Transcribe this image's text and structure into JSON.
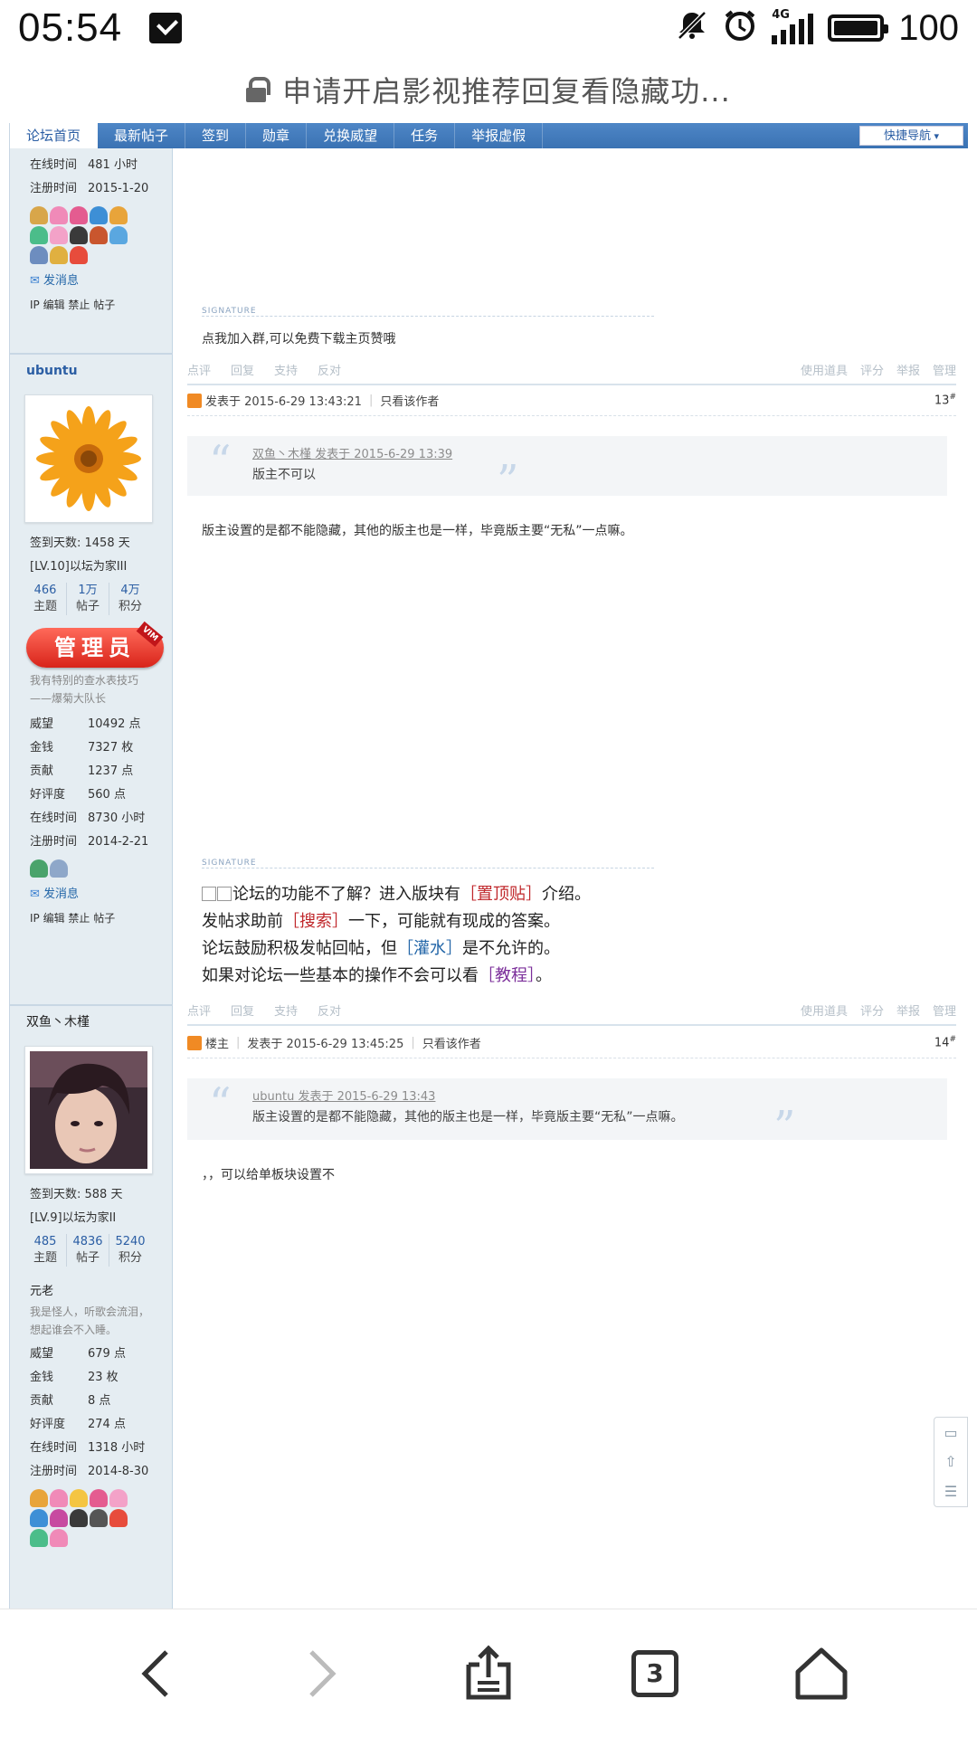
{
  "status_bar": {
    "time": "05:54",
    "alarm_icon": "alarm-clock-icon",
    "mute_icon": "bell-off-icon",
    "network": "4G",
    "battery": "100"
  },
  "url_bar": {
    "title": "申请开启影视推荐回复看隐藏功..."
  },
  "forum_nav": {
    "items": [
      "论坛首页",
      "最新帖子",
      "签到",
      "勋章",
      "兑换威望",
      "任务",
      "举报虚假"
    ],
    "quick_nav": "快捷导航"
  },
  "post12_tail": {
    "online_label": "在线时间",
    "online_value": "481 小时",
    "register_label": "注册时间",
    "register_value": "2015-1-20",
    "pm": "发消息",
    "ip_line": "IP 编辑 禁止 帖子",
    "signature_label": "SIGNATURE",
    "signature": "点我加入群,可以免费下载主页赞哦",
    "actions": [
      "点评",
      "回复",
      "支持",
      "反对"
    ],
    "actions_right": [
      "使用道具",
      "评分",
      "举报",
      "管理"
    ]
  },
  "post13": {
    "username": "ubuntu",
    "posted": "发表于 2015-6-29 13:43:21",
    "only_author": "只看该作者",
    "floor": "13",
    "quote_by": "双鱼丶木槿 发表于 2015-6-29 13:39",
    "quote_text": "版主不可以",
    "body": "版主设置的是都不能隐藏，其他的版主也是一样，毕竟版主要“无私”一点嘛。",
    "signin_days": "签到天数: 1458 天",
    "level": "[LV.10]以坛为家III",
    "stats": [
      {
        "n": "466",
        "l": "主题"
      },
      {
        "n": "1万",
        "l": "帖子"
      },
      {
        "n": "4万",
        "l": "积分"
      }
    ],
    "badge": "管理员",
    "badge_corner": "VIM",
    "motto": "我有特别的查水表技巧——爆菊大队长",
    "info": [
      {
        "k": "威望",
        "v": "10492 点"
      },
      {
        "k": "金钱",
        "v": "7327 枚"
      },
      {
        "k": "贡献",
        "v": "1237 点"
      },
      {
        "k": "好评度",
        "v": "560 点"
      },
      {
        "k": "在线时间",
        "v": "8730 小时"
      },
      {
        "k": "注册时间",
        "v": "2014-2-21"
      }
    ],
    "pm": "发消息",
    "ip_line": "IP 编辑 禁止 帖子",
    "signature_label": "SIGNATURE",
    "sig_lines": [
      {
        "pre": "论坛的功能不了解？进入版块有",
        "link": "［置顶贴］",
        "post": "介绍。"
      },
      {
        "pre": "发帖求助前",
        "link": "［搜索］",
        "post": "一下，可能就有现成的答案。"
      },
      {
        "pre": "论坛鼓励积极发帖回帖，但",
        "link": "［灌水］",
        "post": "是不允许的。"
      },
      {
        "pre": "如果对论坛一些基本的操作不会可以看",
        "link": "［教程］",
        "post": "。"
      }
    ],
    "actions": [
      "点评",
      "回复",
      "支持",
      "反对"
    ],
    "actions_right": [
      "使用道具",
      "评分",
      "举报",
      "管理"
    ]
  },
  "post14": {
    "username": "双鱼丶木槿",
    "op_tag": "楼主",
    "posted": "发表于 2015-6-29 13:45:25",
    "only_author": "只看该作者",
    "floor": "14",
    "quote_by": "ubuntu 发表于 2015-6-29 13:43",
    "quote_text": "版主设置的是都不能隐藏，其他的版主也是一样，毕竟版主要“无私”一点嘛。",
    "body": "，，可以给单板块设置不",
    "signin_days": "签到天数: 588 天",
    "level": "[LV.9]以坛为家II",
    "stats": [
      {
        "n": "485",
        "l": "主题"
      },
      {
        "n": "4836",
        "l": "帖子"
      },
      {
        "n": "5240",
        "l": "积分"
      }
    ],
    "grade": "元老",
    "motto": "我是怪人，听歌会流泪，想起谁会不入睡。",
    "info": [
      {
        "k": "威望",
        "v": "679 点"
      },
      {
        "k": "金钱",
        "v": "23 枚"
      },
      {
        "k": "贡献",
        "v": "8 点"
      },
      {
        "k": "好评度",
        "v": "274 点"
      },
      {
        "k": "在线时间",
        "v": "1318 小时"
      },
      {
        "k": "注册时间",
        "v": "2014-8-30"
      }
    ]
  },
  "bottom_nav": {
    "tab_count": "3"
  },
  "colors": {
    "nav_blue": "#3a72b3",
    "sidebar_bg": "#e5edf2",
    "link_blue": "#2366a8",
    "red_badge": "#d8241a"
  }
}
